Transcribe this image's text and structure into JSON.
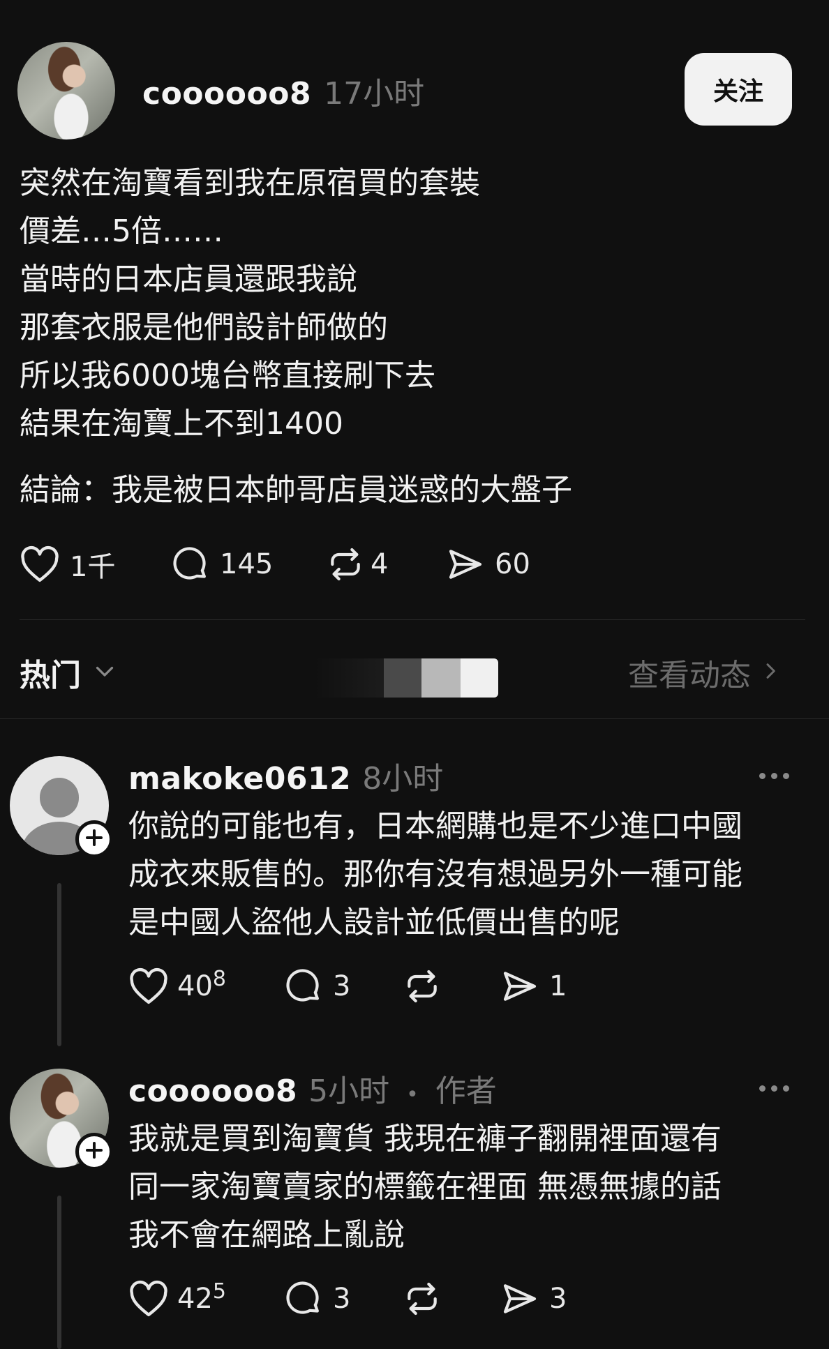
{
  "post": {
    "username": "coooooo8",
    "time": "17小时",
    "follow_label": "关注",
    "lines": [
      "突然在淘寶看到我在原宿買的套裝",
      "價差…5倍……",
      "當時的日本店員還跟我說",
      "那套衣服是他們設計師做的",
      "所以我6000塊台幣直接刷下去",
      "結果在淘寶上不到1400"
    ],
    "conclusion": "結論：我是被日本帥哥店員迷惑的大盤子",
    "stats": {
      "likes": "1千",
      "comments": "145",
      "reposts": "4",
      "shares": "60"
    }
  },
  "sort_bar": {
    "label": "热门",
    "view_activity": "查看动态"
  },
  "replies": [
    {
      "username": "makoke0612",
      "time": "8小时",
      "lines": [
        "你說的可能也有，日本網購也是不少進口中國",
        "成衣來販售的。那你有沒有想過另外一種可能",
        "是中國人盜他人設計並低價出售的呢"
      ],
      "likes_main": "40",
      "likes_sup": "8",
      "comments": "3",
      "shares": "1"
    },
    {
      "username": "coooooo8",
      "time": "5小时",
      "author_dot": "•",
      "author_tag": "作者",
      "lines": [
        "我就是買到淘寶貨 我現在褲子翻開裡面還有",
        "同一家淘寶賣家的標籤在裡面 無憑無據的話",
        "我不會在網路上亂說"
      ],
      "likes_main": "42",
      "likes_sup": "5",
      "comments": "3",
      "shares": "3"
    }
  ]
}
